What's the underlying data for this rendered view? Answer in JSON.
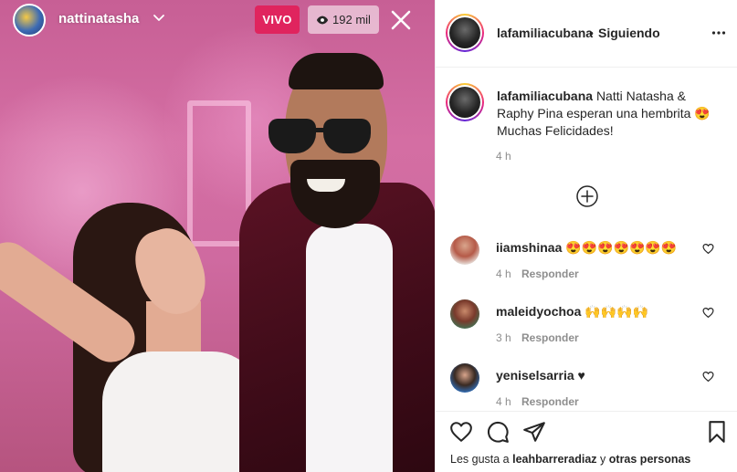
{
  "live": {
    "username": "nattinatasha",
    "badge": "VIVO",
    "viewers": "192 mil"
  },
  "header": {
    "username": "lafamiliacubana",
    "separator": "•",
    "follow_status": "Siguiendo"
  },
  "caption": {
    "username": "lafamiliacubana",
    "text": "Natti Natasha & Raphy Pina esperan una hembrita 😍 Muchas Felicidades!",
    "time": "4 h"
  },
  "comments": [
    {
      "username": "iiamshinaa",
      "text": "😍😍😍😍😍😍😍",
      "time": "4 h",
      "reply_label": "Responder"
    },
    {
      "username": "maleidyochoa",
      "text": "🙌🙌🙌🙌",
      "time": "3 h",
      "reply_label": "Responder"
    },
    {
      "username": "yeniselsarria",
      "text": "♥",
      "time": "4 h",
      "reply_label": "Responder"
    }
  ],
  "likes": {
    "prefix": "Les gusta a",
    "user": "leahbarreradiaz",
    "connector": "y",
    "others": "otras personas"
  },
  "icons": {
    "header_more": "more-dots-icon",
    "load_more": "plus-circle-icon",
    "comment_like": "heart-outline-icon",
    "like": "heart-icon",
    "comment": "comment-bubble-icon",
    "share": "paper-plane-icon",
    "save": "bookmark-icon",
    "close": "close-icon",
    "viewers": "eye-icon",
    "chevron": "chevron-down-icon"
  },
  "colors": {
    "live_badge": "#e0245e",
    "text_primary": "#262626",
    "text_secondary": "#8e8e8e",
    "border": "#efefef"
  }
}
